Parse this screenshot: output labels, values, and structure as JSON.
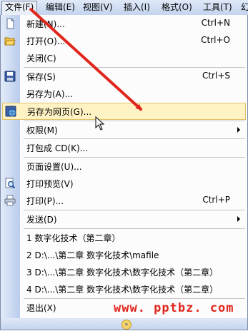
{
  "menubar": {
    "items": [
      {
        "label": "文件(F)"
      },
      {
        "label": "编辑(E)"
      },
      {
        "label": "视图(V)"
      },
      {
        "label": "插入(I)"
      },
      {
        "label": "格式(O)"
      },
      {
        "label": "工具(T)"
      },
      {
        "label": "幻"
      }
    ]
  },
  "menu": {
    "items": [
      {
        "label": "新建(N)...",
        "shortcut": "Ctrl+N",
        "icon": "new-document-icon"
      },
      {
        "label": "打开(O)...",
        "shortcut": "Ctrl+O",
        "icon": "open-folder-icon"
      },
      {
        "label": "关闭(C)"
      },
      {
        "label": "保存(S)",
        "shortcut": "Ctrl+S",
        "icon": "save-disk-icon"
      },
      {
        "label": "另存为(A)..."
      },
      {
        "label": "另存为网页(G)...",
        "icon": "save-web-page-icon"
      },
      {
        "label": "权限(M)"
      },
      {
        "label": "打包成 CD(K)..."
      },
      {
        "label": "页面设置(U)..."
      },
      {
        "label": "打印预览(V)",
        "icon": "print-preview-icon"
      },
      {
        "label": "打印(P)...",
        "shortcut": "Ctrl+P",
        "icon": "printer-icon"
      },
      {
        "label": "发送(D)"
      },
      {
        "label": "1 数字化技术（第二章）"
      },
      {
        "label": "2 D:\\...\\第二章 数字化技术\\mafile"
      },
      {
        "label": "3 D:\\...\\第二章 数字化技术\\数字化技术（第二章）"
      },
      {
        "label": "4 D:\\...\\第二章 数字化技术\\数字化技术（第二章）"
      },
      {
        "label": "退出(X)"
      }
    ]
  },
  "watermark": "www. pptbz. com",
  "colors": {
    "highlight": "#fff3c4",
    "arrow": "#e0261c",
    "gutter": "#c5d5ee"
  }
}
